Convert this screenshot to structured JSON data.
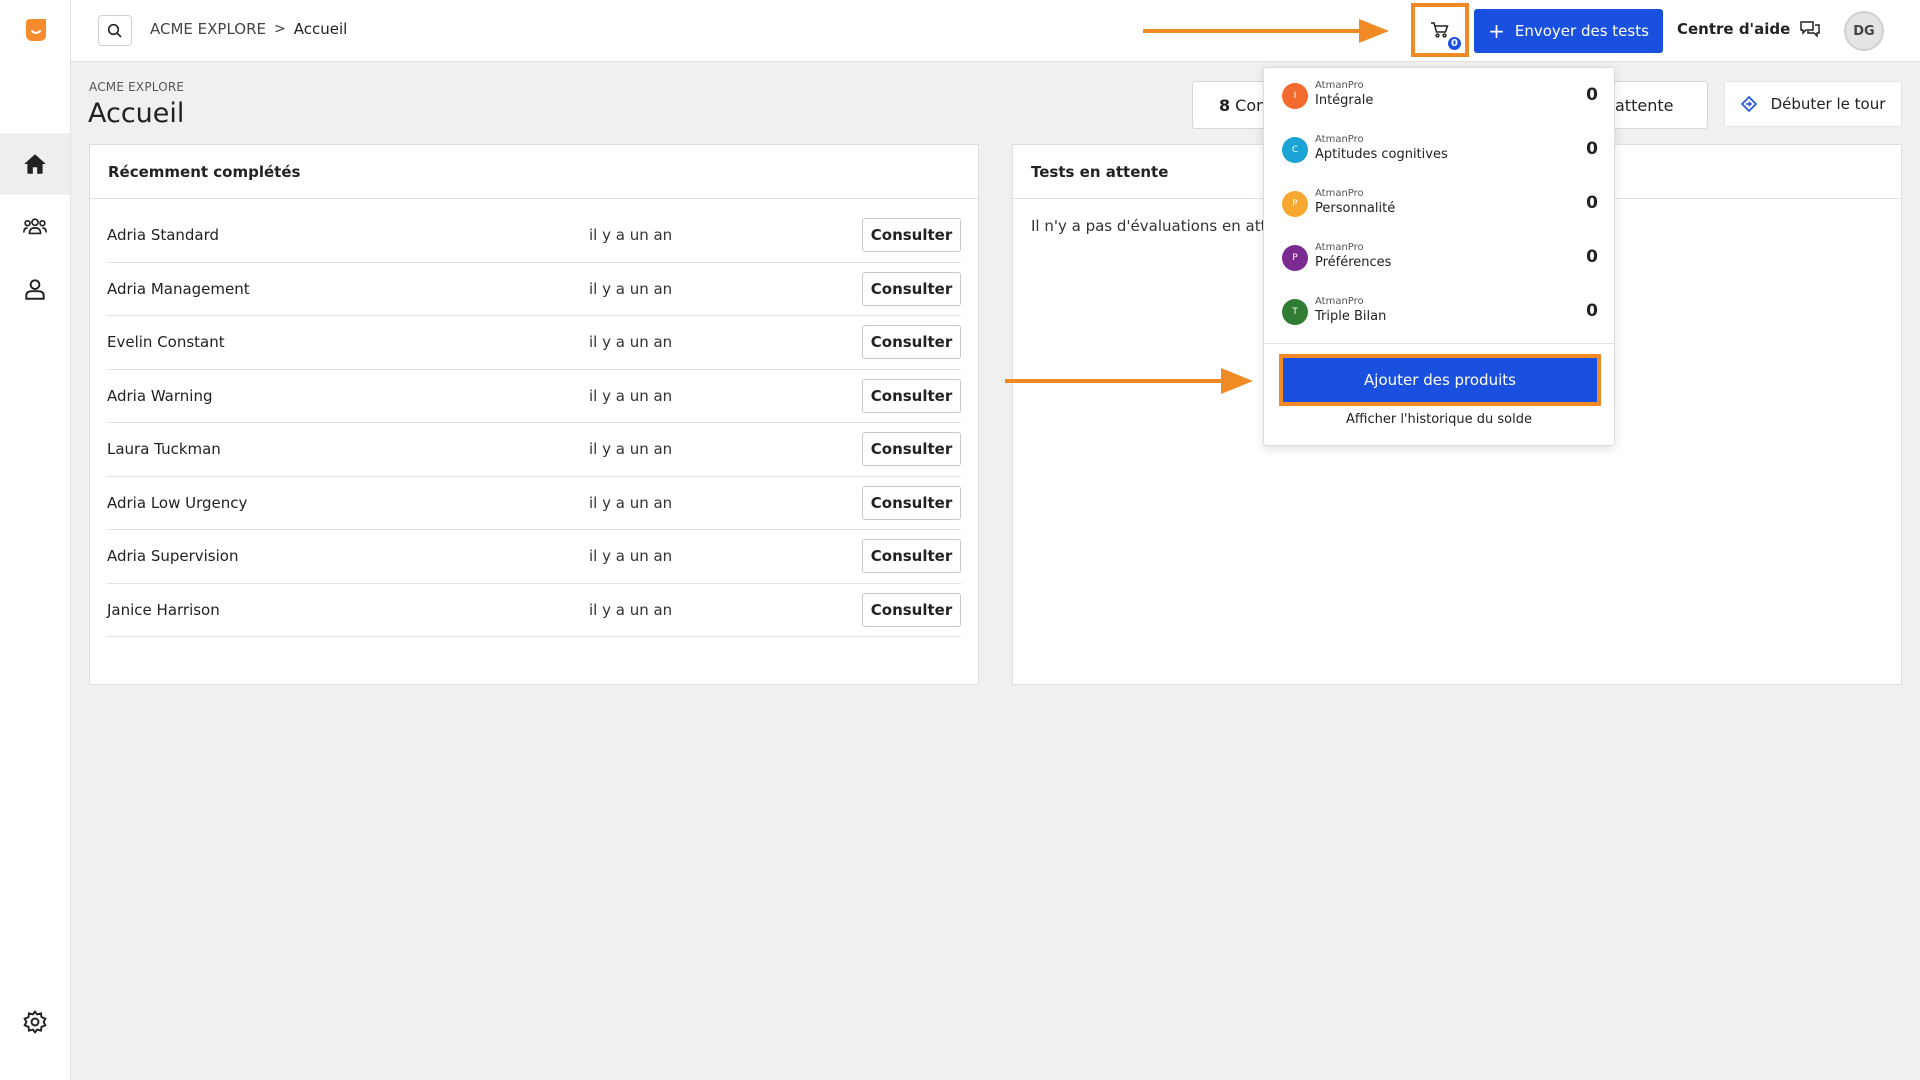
{
  "colors": {
    "accent_blue": "#1a50e0",
    "highlight_orange": "#f08a24",
    "logo_orange": "#f58b2d"
  },
  "sidebar": {
    "items": [
      {
        "icon": "home-icon",
        "active": true
      },
      {
        "icon": "users-icon",
        "active": false
      },
      {
        "icon": "user-icon",
        "active": false
      },
      {
        "icon": "gear-icon",
        "active": false
      }
    ]
  },
  "topbar": {
    "breadcrumb": {
      "org": "ACME EXPLORE",
      "separator": ">",
      "page": "Accueil"
    },
    "cart": {
      "icon": "cart-icon",
      "badge": "0"
    },
    "send_button": "Envoyer des tests",
    "help_link": "Centre d'aide",
    "avatar_initials": "DG"
  },
  "header": {
    "org_label": "ACME EXPLORE",
    "title": "Accueil",
    "stat1": {
      "count": "8",
      "label": "Con"
    },
    "stat2": {
      "label": "attente"
    },
    "tour_button": "Débuter le tour"
  },
  "recent": {
    "title": "Récemment complétés",
    "consult_label": "Consulter",
    "rows": [
      {
        "name": "Adria Standard",
        "when": "il y a un an"
      },
      {
        "name": "Adria Management",
        "when": "il y a un an"
      },
      {
        "name": "Evelin Constant",
        "when": "il y a un an"
      },
      {
        "name": "Adria Warning",
        "when": "il y a un an"
      },
      {
        "name": "Laura Tuckman",
        "when": "il y a un an"
      },
      {
        "name": "Adria Low Urgency",
        "when": "il y a un an"
      },
      {
        "name": "Adria Supervision",
        "when": "il y a un an"
      },
      {
        "name": "Janice Harrison",
        "when": "il y a un an"
      }
    ]
  },
  "pending": {
    "title": "Tests en attente",
    "empty_text": "Il n'y a pas d'évaluations en atter"
  },
  "cart_dropdown": {
    "products": [
      {
        "brand": "AtmanPro",
        "name": "Intégrale",
        "letter": "I",
        "color": "#f26a2e",
        "count": "0"
      },
      {
        "brand": "AtmanPro",
        "name": "Aptitudes cognitives",
        "letter": "C",
        "color": "#1aa3d4",
        "count": "0"
      },
      {
        "brand": "AtmanPro",
        "name": "Personnalité",
        "letter": "P",
        "color": "#f7a830",
        "count": "0"
      },
      {
        "brand": "AtmanPro",
        "name": "Préférences",
        "letter": "P",
        "color": "#7b2a8f",
        "count": "0"
      },
      {
        "brand": "AtmanPro",
        "name": "Triple Bilan",
        "letter": "T",
        "color": "#2e7d32",
        "count": "0"
      }
    ],
    "add_button": "Ajouter des produits",
    "history_link": "Afficher l'historique du solde"
  }
}
